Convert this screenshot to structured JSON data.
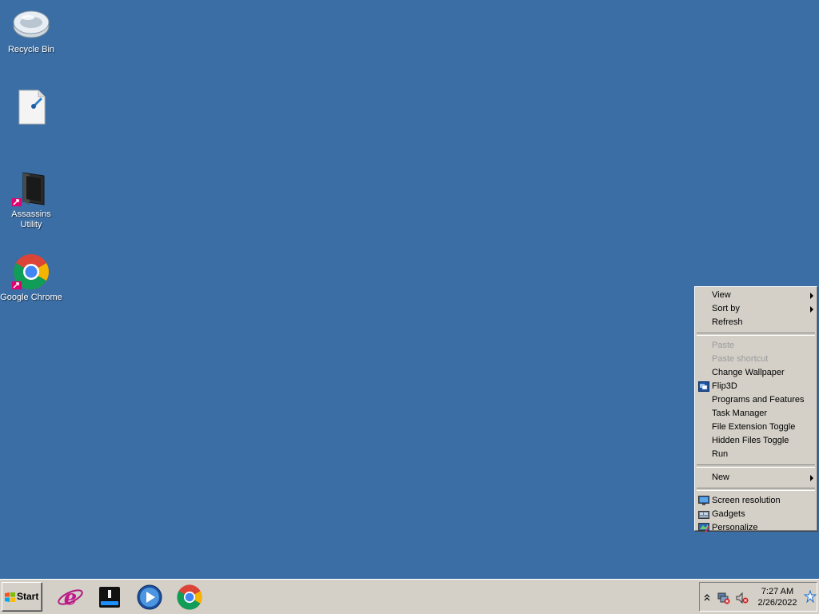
{
  "desktop": {
    "background": "#3b6ea5",
    "icons": [
      {
        "label": "Recycle Bin",
        "icon": "recycle-bin-icon"
      },
      {
        "label": "",
        "icon": "document-shortcut-icon"
      },
      {
        "label": "Assassins Utility",
        "icon": "black-folder-icon"
      },
      {
        "label": "Google Chrome",
        "icon": "chrome-icon"
      }
    ]
  },
  "context_menu": {
    "groups": [
      [
        {
          "label": "View",
          "submenu": true,
          "enabled": true
        },
        {
          "label": "Sort by",
          "submenu": true,
          "enabled": true
        },
        {
          "label": "Refresh",
          "enabled": true
        }
      ],
      [
        {
          "label": "Paste",
          "enabled": false
        },
        {
          "label": "Paste shortcut",
          "enabled": false
        },
        {
          "label": "Change Wallpaper",
          "enabled": true
        },
        {
          "label": "Flip3D",
          "enabled": true,
          "icon": "flip3d-icon"
        },
        {
          "label": "Programs and Features",
          "enabled": true
        },
        {
          "label": "Task Manager",
          "enabled": true
        },
        {
          "label": "File Extension Toggle",
          "enabled": true
        },
        {
          "label": "Hidden Files Toggle",
          "enabled": true
        },
        {
          "label": "Run",
          "enabled": true
        }
      ],
      [
        {
          "label": "New",
          "submenu": true,
          "enabled": true
        }
      ],
      [
        {
          "label": "Screen resolution",
          "enabled": true,
          "icon": "monitor-icon"
        },
        {
          "label": "Gadgets",
          "enabled": true,
          "icon": "gadgets-icon"
        },
        {
          "label": "Personalize",
          "enabled": true,
          "icon": "personalize-icon"
        }
      ]
    ]
  },
  "taskbar": {
    "start_label": "Start",
    "quick_launch": [
      "internet-explorer-icon",
      "explorer-drive-icon",
      "media-player-icon",
      "chrome-icon"
    ],
    "tray": {
      "icons": [
        "show-hidden-icons-chevron",
        "network-error-icon",
        "volume-muted-icon",
        "action-center-icon"
      ],
      "time": "7:27 AM",
      "date": "2/26/2022"
    }
  }
}
